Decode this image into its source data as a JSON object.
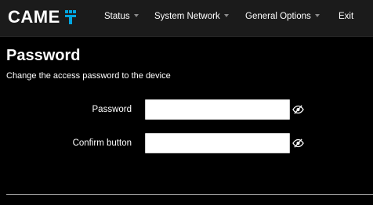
{
  "brand": {
    "name": "CAME"
  },
  "nav": {
    "items": [
      {
        "label": "Status",
        "has_dropdown": true
      },
      {
        "label": "System Network",
        "has_dropdown": true
      },
      {
        "label": "General Options",
        "has_dropdown": true
      },
      {
        "label": "Exit",
        "has_dropdown": false
      }
    ]
  },
  "page": {
    "title": "Password",
    "description": "Change the access password to the device"
  },
  "form": {
    "password": {
      "label": "Password",
      "value": "",
      "icon": "eye-slash-icon"
    },
    "confirm": {
      "label": "Confirm button",
      "value": "",
      "icon": "eye-slash-icon"
    }
  },
  "colors": {
    "background": "#000000",
    "navbar": "#1b1b1b",
    "brand_accent": "#00a6e0",
    "input_background": "#ffffff"
  }
}
